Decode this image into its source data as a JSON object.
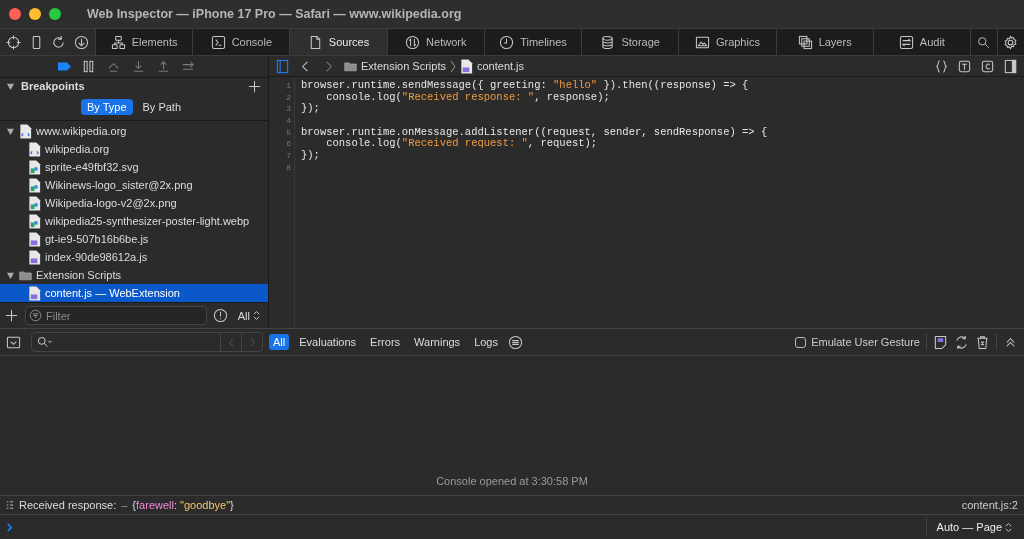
{
  "window": {
    "title": "Web Inspector — iPhone 17 Pro — Safari — www.wikipedia.org"
  },
  "tabs": [
    {
      "label": "Elements",
      "selected": false
    },
    {
      "label": "Console",
      "selected": false
    },
    {
      "label": "Sources",
      "selected": true
    },
    {
      "label": "Network",
      "selected": false
    },
    {
      "label": "Timelines",
      "selected": false
    },
    {
      "label": "Storage",
      "selected": false
    },
    {
      "label": "Graphics",
      "selected": false
    },
    {
      "label": "Layers",
      "selected": false
    },
    {
      "label": "Audit",
      "selected": false
    }
  ],
  "navigator": {
    "breakpoints_active": true,
    "section": {
      "title": "Breakpoints",
      "expanded": true
    },
    "scopes": [
      {
        "label": "By Type",
        "selected": true
      },
      {
        "label": "By Path",
        "selected": false
      }
    ],
    "tree": [
      {
        "label": "www.wikipedia.org",
        "kind": "document",
        "expanded": true,
        "selected": false,
        "children": [
          {
            "label": "wikipedia.org",
            "kind": "document",
            "selected": false
          },
          {
            "label": "sprite-e49fbf32.svg",
            "kind": "image",
            "selected": false
          },
          {
            "label": "Wikinews-logo_sister@2x.png",
            "kind": "image",
            "selected": false
          },
          {
            "label": "Wikipedia-logo-v2@2x.png",
            "kind": "image",
            "selected": false
          },
          {
            "label": "wikipedia25-synthesizer-poster-light.webp",
            "kind": "image",
            "selected": false
          },
          {
            "label": "gt-ie9-507b16b6be.js",
            "kind": "script",
            "selected": false
          },
          {
            "label": "index-90de98612a.js",
            "kind": "script",
            "selected": false
          }
        ]
      },
      {
        "label": "Extension Scripts",
        "kind": "folder",
        "expanded": true,
        "selected": false,
        "children": [
          {
            "label": "content.js — WebExtension",
            "kind": "script",
            "selected": true
          }
        ]
      }
    ],
    "filter": {
      "placeholder": "Filter"
    },
    "scope_select": "All"
  },
  "editor": {
    "breadcrumbs": [
      {
        "label": "Extension Scripts",
        "kind": "folder"
      },
      {
        "label": "content.js",
        "kind": "script"
      }
    ],
    "lines": [
      {
        "number": "1",
        "tokens": [
          {
            "text": "browser.runtime.sendMessage({ greeting: ",
            "kind": "plain"
          },
          {
            "text": "\"hello\"",
            "kind": "string"
          },
          {
            "text": " }).then((response) => {",
            "kind": "plain"
          }
        ]
      },
      {
        "number": "2",
        "tokens": [
          {
            "text": "    console.log(",
            "kind": "plain"
          },
          {
            "text": "\"Received response: \"",
            "kind": "string"
          },
          {
            "text": ", response);",
            "kind": "plain"
          }
        ]
      },
      {
        "number": "3",
        "tokens": [
          {
            "text": "});",
            "kind": "plain"
          }
        ]
      },
      {
        "number": "4"
      },
      {
        "number": "5",
        "tokens": [
          {
            "text": "browser.runtime.onMessage.addListener((request, sender, sendResponse) => {",
            "kind": "plain"
          }
        ]
      },
      {
        "number": "6",
        "tokens": [
          {
            "text": "    console.log(",
            "kind": "plain"
          },
          {
            "text": "\"Received request: \"",
            "kind": "string"
          },
          {
            "text": ", request);",
            "kind": "plain"
          }
        ]
      },
      {
        "number": "7",
        "tokens": [
          {
            "text": "});",
            "kind": "plain"
          }
        ]
      },
      {
        "number": "8"
      }
    ]
  },
  "console": {
    "filters": [
      {
        "label": "All",
        "selected": true
      },
      {
        "label": "Evaluations",
        "selected": false
      },
      {
        "label": "Errors",
        "selected": false
      },
      {
        "label": "Warnings",
        "selected": false
      },
      {
        "label": "Logs",
        "selected": false
      }
    ],
    "emulate_user_gesture": {
      "label": "Emulate User Gesture",
      "checked": false
    },
    "notice": "Console opened at 3:30:58 PM",
    "messages": [
      {
        "text": "Received response:",
        "dash": "–",
        "object": [
          {
            "text": "{",
            "kind": "punct"
          },
          {
            "text": "farewell",
            "kind": "key"
          },
          {
            "text": ": ",
            "kind": "punct"
          },
          {
            "text": "\"goodbye\"",
            "kind": "string"
          },
          {
            "text": "}",
            "kind": "punct"
          }
        ],
        "source": "content.js:2"
      }
    ],
    "context": "Auto — Page"
  }
}
